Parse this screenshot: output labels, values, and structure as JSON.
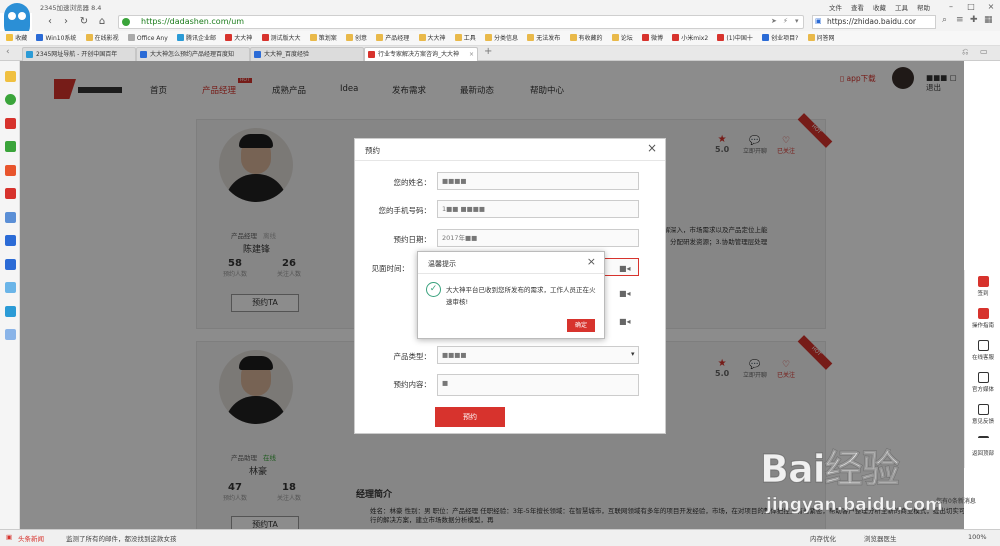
{
  "browser": {
    "title": "2345加速浏览器 8.4",
    "menu": [
      "文件",
      "查看",
      "收藏",
      "工具",
      "帮助"
    ],
    "url": "https://dadashen.com/um",
    "search_url": "https://zhidao.baidu.cor",
    "bookmarks": [
      "收藏",
      "Win10系统",
      "在线影视",
      "Office Any",
      "腾讯企业邮",
      "大大神",
      "测试版大大",
      "策划案",
      "创意",
      "产品经理",
      "大大神",
      "工具",
      "分类信息",
      "无法发布",
      "有收藏的",
      "论坛",
      "微博",
      "小米mix2",
      "(1)中国十",
      "创业项目?",
      "问答网"
    ],
    "tabs": [
      {
        "label": "2345网址导航 - 开创中国百年",
        "active": false
      },
      {
        "label": "大大神怎么预约产品经理百度知",
        "active": false
      },
      {
        "label": "大大神_百度经验",
        "active": false
      },
      {
        "label": "行业专家解决方案咨询_大大神",
        "active": true
      }
    ]
  },
  "site": {
    "nav": [
      "首页",
      "产品经理",
      "成熟产品",
      "Idea",
      "发布需求",
      "最新动态",
      "帮助中心"
    ],
    "active_nav": 1,
    "hot_badge": "HOT",
    "app_download": "app下载",
    "logout": "退出"
  },
  "managers": [
    {
      "role": "产品经理",
      "status": "离线",
      "name": "陈建锋",
      "appointments": "58",
      "appointments_label": "预约人数",
      "followers": "26",
      "followers_label": "关注人数",
      "book_label": "预约TA",
      "rating": "5.0",
      "action_book": "立即开聊",
      "action_follow": "已关注",
      "ribbon": "HOT"
    },
    {
      "role": "产品助理",
      "status": "在线",
      "name": "林豪",
      "appointments": "47",
      "appointments_label": "预约人数",
      "followers": "18",
      "followers_label": "关注人数",
      "book_label": "预约TA",
      "rating": "5.0",
      "action_book": "立即开聊",
      "action_follow": "已关注",
      "ribbon": "HOT"
    }
  ],
  "intro": {
    "title": "经理简介",
    "text": "姓名：林豪 性别：男 职位：产品经理 任职经验：3年-5年擅长领域：在智慧城市，互联网领域有多年的项目开发经验，市场，在对项目的整体把控上有着紧密，帮助客户整理分析全新的商业模式，提出切实可行的解决方案，建立市场数据分析模型，再",
    "snippet_right": "了解深入，市场需求以及产品定位上能",
    "snippet_right2": "划，分配研发资源；3.协助管理层处理"
  },
  "right_sidebar": [
    "签到",
    "操作指南",
    "在线客服",
    "官方媒体",
    "意见反馈",
    "返回顶部"
  ],
  "modal": {
    "title": "预约",
    "fields": [
      {
        "label": "您的姓名：",
        "value": "■■■■"
      },
      {
        "label": "您的手机号码：",
        "value": "1■■ ■■■■"
      },
      {
        "label": "预约日期：",
        "value": "2017年■■"
      },
      {
        "label": "见面时间：",
        "value": ""
      },
      {
        "label": "产品类型：",
        "value": "■■■■"
      },
      {
        "label": "预约内容：",
        "value": "■"
      }
    ],
    "submit": "预约"
  },
  "alert": {
    "title": "温馨提示",
    "message": "大大神平台已收到您所发布的需求，工作人员正在火速审核!",
    "ok": "确定"
  },
  "statusbar": {
    "news": "头条新闻",
    "ticker": "监测了所有的邮件，都没找到这款女孩",
    "optimize": "内存优化",
    "doctor": "浏览器医生",
    "zoom": "100%"
  },
  "watermark": {
    "logo": "Bai经验",
    "sub": "jingyan.baidu.com"
  },
  "message_bubble": "您有0条新消息",
  "colors": {
    "brand": "#d7332d",
    "success": "#3aa27e",
    "url": "#1a7c1a"
  }
}
